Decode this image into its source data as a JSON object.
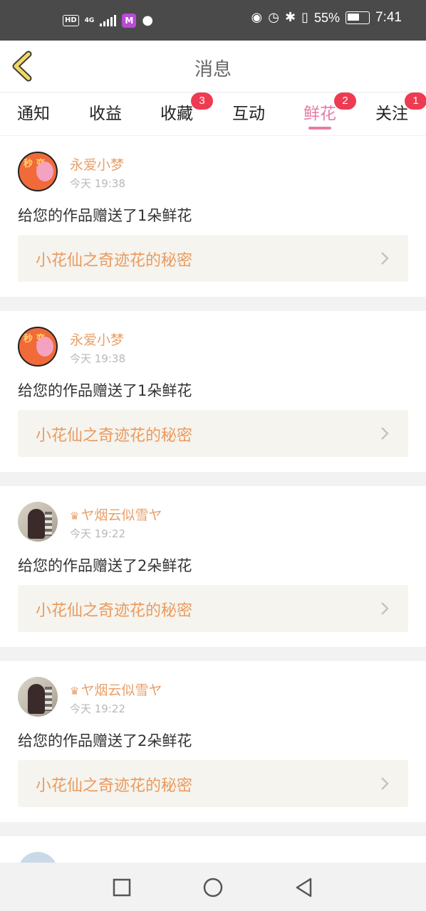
{
  "status_bar": {
    "hd": "HD",
    "network": "4G",
    "app_icon_letter": "M",
    "battery": "55%",
    "time": "7:41"
  },
  "header": {
    "title": "消息"
  },
  "tabs": [
    {
      "label": "通知",
      "badge": "",
      "active": false
    },
    {
      "label": "收益",
      "badge": "",
      "active": false
    },
    {
      "label": "收藏",
      "badge": "3",
      "active": false
    },
    {
      "label": "互动",
      "badge": "",
      "active": false
    },
    {
      "label": "鲜花",
      "badge": "2",
      "active": true
    },
    {
      "label": "关注",
      "badge": "1",
      "active": false
    }
  ],
  "messages": [
    {
      "user": "永爱小梦",
      "avatar_text": "秒 变",
      "time": "今天 19:38",
      "text": "给您的作品赠送了1朵鲜花",
      "work": "小花仙之奇迹花的秘密"
    },
    {
      "user": "永爱小梦",
      "avatar_text": "秒 变",
      "time": "今天 19:38",
      "text": "给您的作品赠送了1朵鲜花",
      "work": "小花仙之奇迹花的秘密"
    },
    {
      "user": "ヤ烟云似雪ヤ",
      "crown": "♛",
      "time": "今天 19:22",
      "text": "给您的作品赠送了2朵鲜花",
      "work": "小花仙之奇迹花的秘密"
    },
    {
      "user": "ヤ烟云似雪ヤ",
      "crown": "♛",
      "time": "今天 19:22",
      "text": "给您的作品赠送了2朵鲜花",
      "work": "小花仙之奇迹花的秘密"
    }
  ],
  "colors": {
    "accent_pink": "#e97aa6",
    "badge_red": "#ee3b52",
    "username_orange": "#e8a06a",
    "work_title_orange": "#eb9a5e"
  }
}
